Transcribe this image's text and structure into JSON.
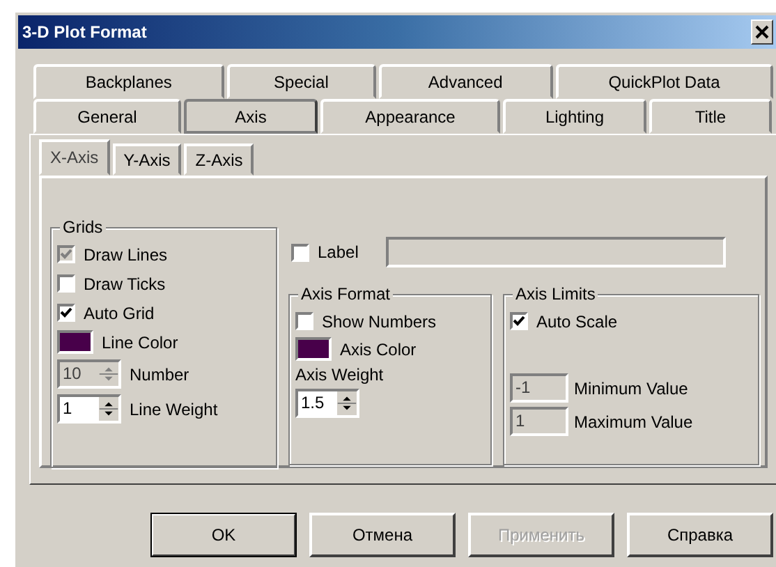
{
  "window": {
    "title": "3-D Plot Format"
  },
  "tab_rows": [
    [
      {
        "label": "Backplanes",
        "selected": false
      },
      {
        "label": "Special",
        "selected": false
      },
      {
        "label": "Advanced",
        "selected": false
      },
      {
        "label": "QuickPlot Data",
        "selected": false
      }
    ],
    [
      {
        "label": "General",
        "selected": false
      },
      {
        "label": "Axis",
        "selected": true
      },
      {
        "label": "Appearance",
        "selected": false
      },
      {
        "label": "Lighting",
        "selected": false
      },
      {
        "label": "Title",
        "selected": false
      }
    ]
  ],
  "subtabs": [
    {
      "label": "X-Axis",
      "selected": true
    },
    {
      "label": "Y-Axis",
      "selected": false
    },
    {
      "label": "Z-Axis",
      "selected": false
    }
  ],
  "grids": {
    "title": "Grids",
    "items": [
      {
        "kind": "checkbox",
        "label": "Draw Lines",
        "checked": true,
        "disabled": true
      },
      {
        "kind": "checkbox",
        "label": "Draw Ticks",
        "checked": false,
        "disabled": false
      },
      {
        "kind": "checkbox",
        "label": "Auto Grid",
        "checked": true,
        "disabled": false
      },
      {
        "kind": "color",
        "label": "Line Color",
        "color": "#48004a"
      },
      {
        "kind": "spin",
        "value": "10",
        "label": "Number",
        "disabled": true
      },
      {
        "kind": "spin",
        "value": "1",
        "label": "Line Weight",
        "disabled": false
      }
    ]
  },
  "label_row": {
    "label": "Label",
    "checked": false
  },
  "axis_format": {
    "title": "Axis Format",
    "items": [
      {
        "kind": "checkbox",
        "label": "Show Numbers",
        "checked": false,
        "disabled": false
      },
      {
        "kind": "color",
        "label": "Axis Color",
        "color": "#48004a"
      },
      {
        "kind": "caption",
        "label": "Axis Weight"
      },
      {
        "kind": "spin",
        "value": "1.5",
        "disabled": false
      }
    ]
  },
  "axis_limits": {
    "title": "Axis Limits",
    "items": [
      {
        "kind": "checkbox",
        "label": "Auto Scale",
        "checked": true,
        "disabled": false
      },
      {
        "kind": "field",
        "value": "-1",
        "label": "Minimum Value",
        "disabled": true
      },
      {
        "kind": "field",
        "value": "1",
        "label": "Maximum Value",
        "disabled": true
      }
    ]
  },
  "buttons": [
    {
      "label": "OK",
      "default": true,
      "disabled": false
    },
    {
      "label": "Отмена",
      "default": false,
      "disabled": false
    },
    {
      "label": "Применить",
      "default": false,
      "disabled": true
    },
    {
      "label": "Справка",
      "default": false,
      "disabled": false
    }
  ]
}
